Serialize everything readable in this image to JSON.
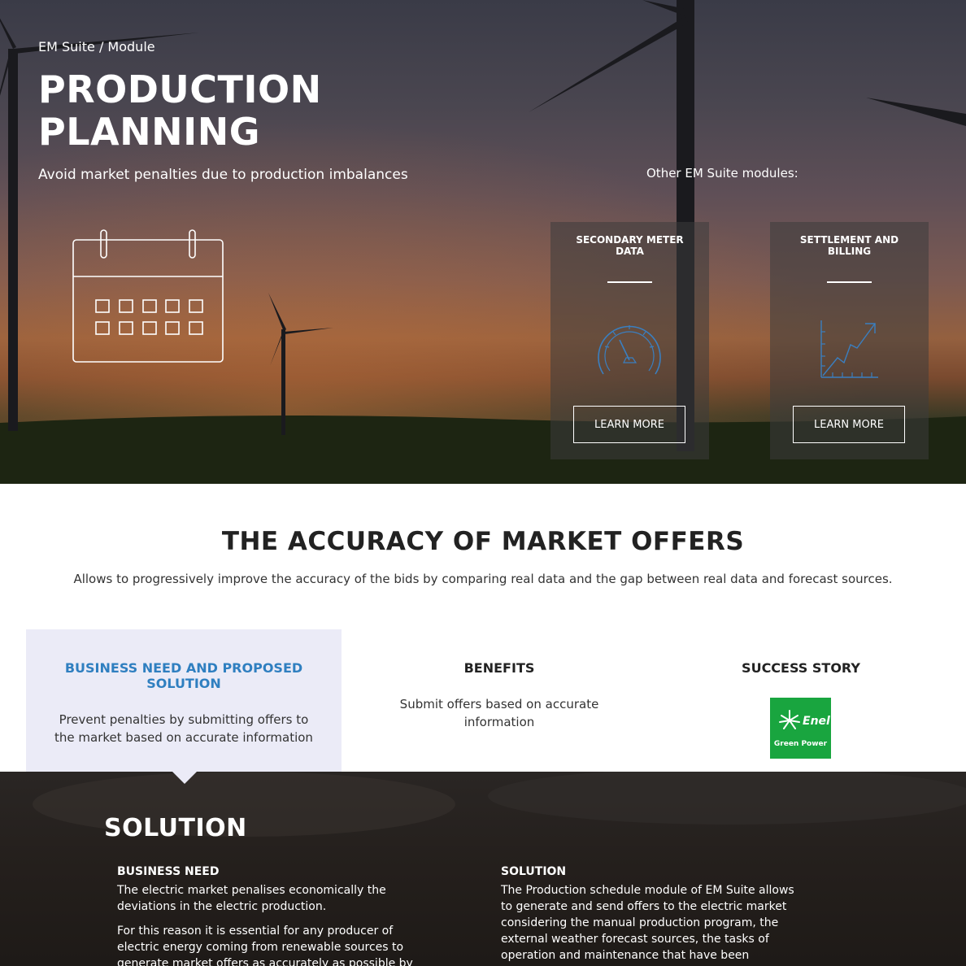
{
  "hero": {
    "breadcrumb": "EM Suite / Module",
    "title_line1": "PRODUCTION",
    "title_line2": "PLANNING",
    "subtitle": "Avoid market penalties due to production imbalances",
    "other_modules_label": "Other EM Suite modules:",
    "modules": [
      {
        "title": "SECONDARY METER DATA",
        "icon": "gauge-icon",
        "button": "LEARN MORE"
      },
      {
        "title": "SETTLEMENT AND BILLING",
        "icon": "growth-chart-icon",
        "button": "LEARN MORE"
      }
    ]
  },
  "accuracy": {
    "heading": "THE ACCURACY OF MARKET OFFERS",
    "description": "Allows to progressively improve the accuracy of the bids by comparing real data and the gap between real data and forecast sources."
  },
  "tabs": [
    {
      "title": "BUSINESS NEED AND PROPOSED SOLUTION",
      "text": "Prevent penalties by submitting offers to the market based on accurate information",
      "active": true
    },
    {
      "title": "BENEFITS",
      "text": "Submit offers based on accurate information"
    },
    {
      "title": "SUCCESS STORY",
      "logo_text": "Enel",
      "logo_subtext": "Green Power"
    }
  ],
  "solution": {
    "title": "SOLUTION",
    "business_need": {
      "heading": "BUSINESS NEED",
      "paragraphs": [
        "The electric market penalises economically the deviations in the electric production.",
        "For this reason it is essential for any producer of electric energy coming from renewable sources to generate market offers as accurately as possible by"
      ]
    },
    "solution_col": {
      "heading": "SOLUTION",
      "paragraphs": [
        "The Production schedule module of EM Suite allows to generate and send offers to the electric market considering the manual production program, the external weather forecast sources, the tasks of operation and maintenance that have been foreseen"
      ]
    }
  },
  "colors": {
    "accent_blue": "#2f7fc0",
    "active_tab_bg": "#ebebf7",
    "enel_green": "#19a53f",
    "icon_blue": "#3a7fc0"
  }
}
